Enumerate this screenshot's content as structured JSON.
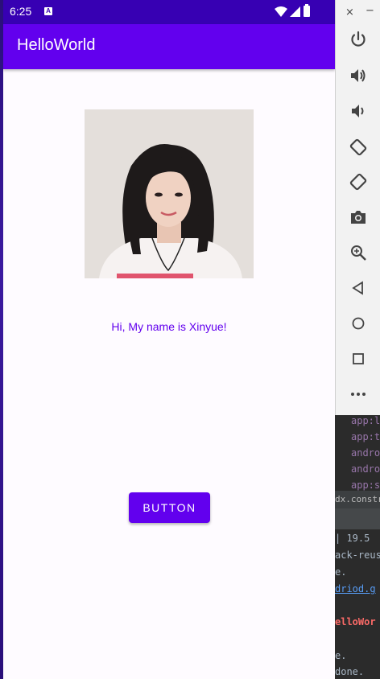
{
  "status_bar": {
    "time": "6:25",
    "notification_icon": "A"
  },
  "app": {
    "title": "HelloWorld",
    "greeting": "Hi, My name is Xinyue!",
    "button_label": "BUTTON",
    "accent_color": "#6200ee",
    "status_color": "#3700b3"
  },
  "emulator_toolbar": {
    "close_label": "×",
    "minimize_label": "−",
    "buttons": [
      "power-icon",
      "volume-up-icon",
      "volume-down-icon",
      "rotate-left-icon",
      "rotate-right-icon",
      "camera-icon",
      "zoom-icon",
      "back-icon",
      "home-icon",
      "overview-icon",
      "more-icon"
    ]
  },
  "ide": {
    "lines": [
      "app:l",
      "app:t",
      "andro",
      "andro",
      "app:s"
    ],
    "tab_label": "dx.constrai",
    "log_lines": [
      "| 19.5",
      "ack-reus",
      "e.",
      "driod.g",
      "elloWor",
      "e.",
      "done."
    ]
  }
}
